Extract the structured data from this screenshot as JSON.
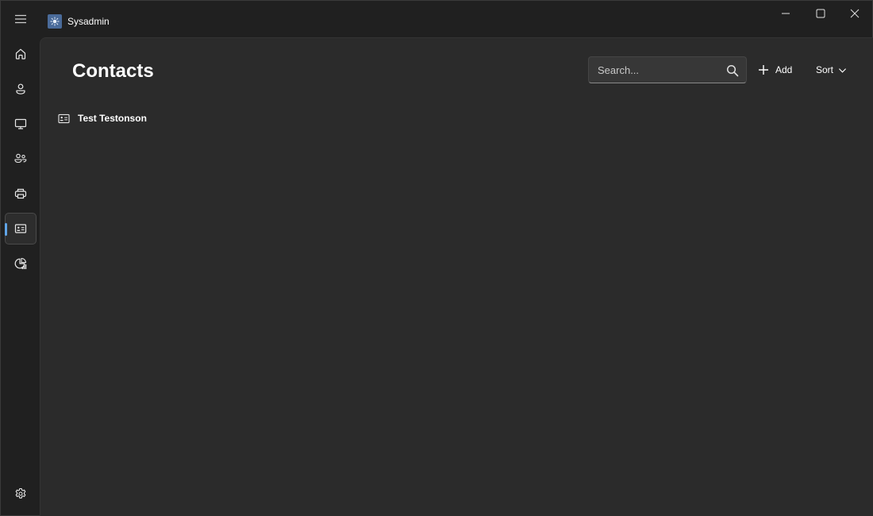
{
  "window": {
    "app_title": "Sysadmin",
    "app_icon": "atom-logo-icon",
    "controls": [
      "minimize",
      "maximize",
      "close"
    ]
  },
  "nav": {
    "items": [
      {
        "id": "home",
        "icon": "home-icon",
        "selected": false
      },
      {
        "id": "users",
        "icon": "person-icon",
        "selected": false
      },
      {
        "id": "devices",
        "icon": "monitor-icon",
        "selected": false
      },
      {
        "id": "groups",
        "icon": "people-icon",
        "selected": false
      },
      {
        "id": "printers",
        "icon": "printer-icon",
        "selected": false
      },
      {
        "id": "contacts",
        "icon": "contact-card-icon",
        "selected": true
      },
      {
        "id": "reports",
        "icon": "chart-icon",
        "selected": false
      }
    ],
    "footer": {
      "id": "settings",
      "icon": "gear-icon"
    },
    "accent": "#60a5e8"
  },
  "page": {
    "title": "Contacts",
    "search": {
      "placeholder": "Search...",
      "value": ""
    },
    "add_label": "Add",
    "sort_label": "Sort"
  },
  "contacts": [
    {
      "name": "Test Testonson",
      "icon": "contact-card-icon"
    }
  ]
}
